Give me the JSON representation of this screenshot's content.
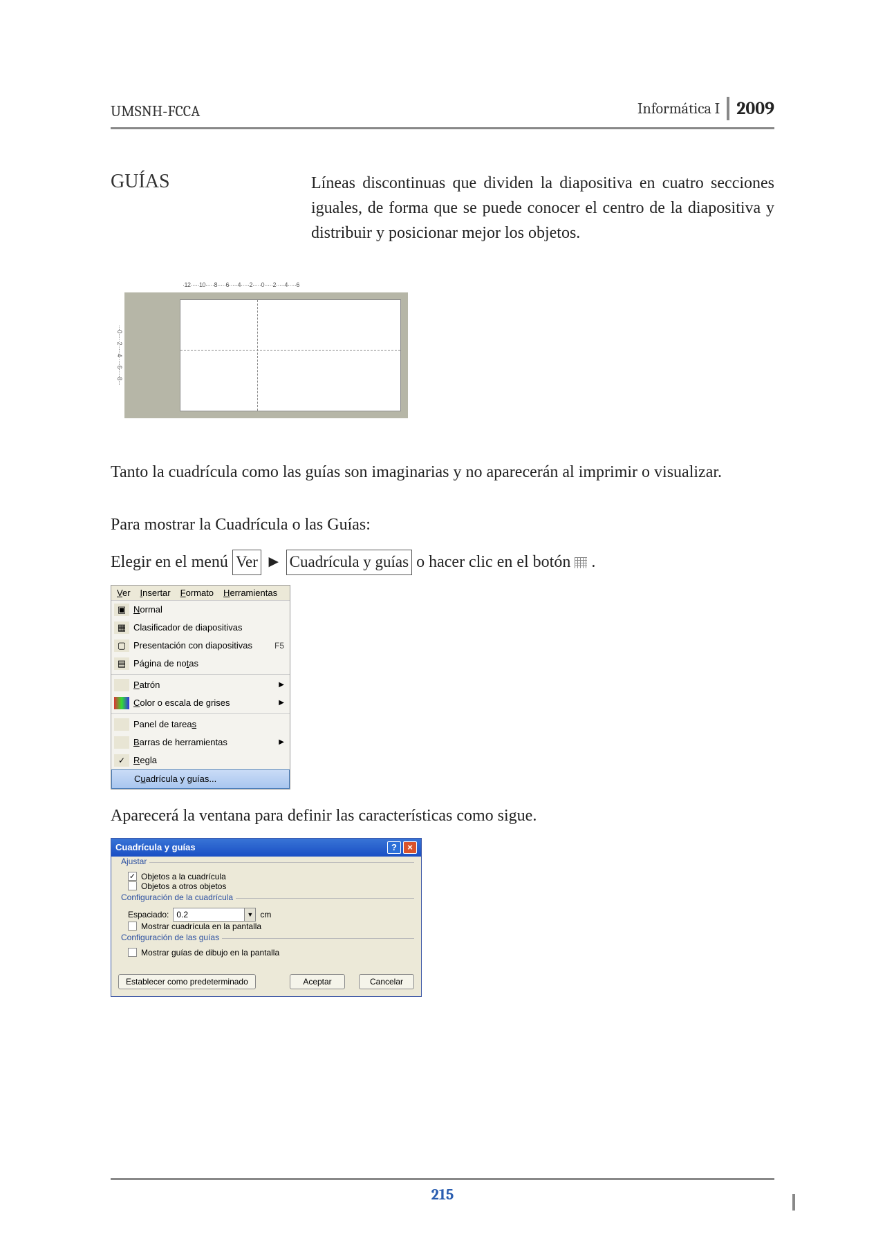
{
  "header": {
    "left": "UMSNH-FCCA",
    "right_label": "Informática I",
    "year": "2009"
  },
  "guias": {
    "title": "GUÍAS",
    "paragraph": "Líneas discontinuas que dividen la diapositiva en cuatro secciones iguales, de forma que se puede conocer el centro de la diapositiva y distribuir y posicionar mejor los objetos."
  },
  "ruler": {
    "top": "·12·····10·····8·····6·····4·····2·····0·····2·····4·····6",
    "left": "···0·····2·····4·····6·····8···"
  },
  "para2": "Tanto la cuadrícula como las guías son imaginarias y no aparecerán al imprimir o visualizar.",
  "para3": "Para mostrar la Cuadrícula o las Guías:",
  "inline": {
    "pre": "Elegir en el menú ",
    "ver": "Ver",
    "arrow": "►",
    "cg": "Cuadrícula y guías",
    "post": " o hacer  clic en el botón  ",
    "dot": "."
  },
  "menu": {
    "bar": {
      "ver": "Ver",
      "insertar": "Insertar",
      "formato": "Formato",
      "herramientas": "Herramientas"
    },
    "items": {
      "normal": "Normal",
      "clasificador": "Clasificador de diapositivas",
      "presentacion": "Presentación con diapositivas",
      "f5": "F5",
      "notas": "Página de notas",
      "patron": "Patrón",
      "color": "Color o escala de grises",
      "panel": "Panel de tareas",
      "barras": "Barras de herramientas",
      "regla": "Regla",
      "cuadricula": "Cuadrícula y guías..."
    }
  },
  "para4": "Aparecerá la ventana para definir las características como sigue.",
  "dialog": {
    "title": "Cuadrícula y guías",
    "group_ajustar": "Ajustar",
    "cb_obj_cuad": "Objetos a la cuadrícula",
    "cb_obj_otros": "Objetos a otros objetos",
    "group_config_cuad": "Configuración de la cuadrícula",
    "espaciado_label": "Espaciado:",
    "espaciado_value": "0.2",
    "espaciado_unit": "cm",
    "cb_mostrar_cuad": "Mostrar cuadrícula en la pantalla",
    "group_config_guias": "Configuración de las guías",
    "cb_mostrar_guias": "Mostrar guías de dibujo en la pantalla",
    "btn_pred": "Establecer como predeterminado",
    "btn_aceptar": "Aceptar",
    "btn_cancelar": "Cancelar"
  },
  "page_number": "215"
}
